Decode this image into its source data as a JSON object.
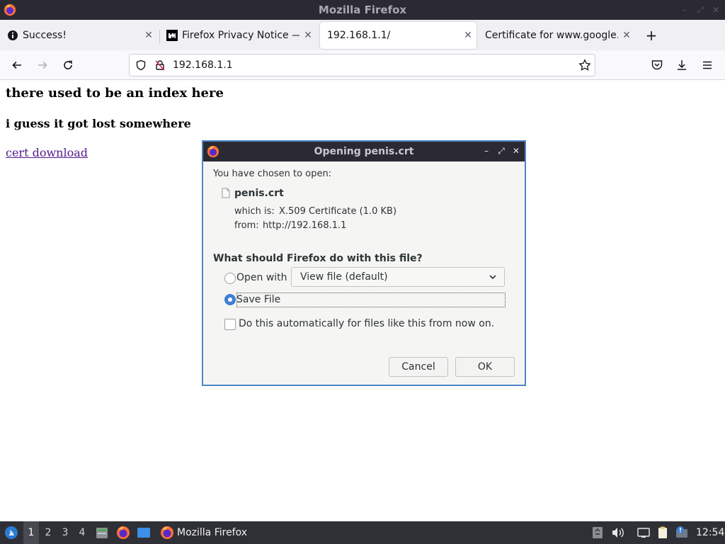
{
  "window": {
    "title": "Mozilla Firefox"
  },
  "tabs": [
    {
      "label": "Success!",
      "icon": "info-icon",
      "active": false
    },
    {
      "label": "Firefox Privacy Notice — ‖",
      "icon": "mozilla-m-icon",
      "active": false
    },
    {
      "label": "192.168.1.1/",
      "icon": "",
      "active": true
    },
    {
      "label": "Certificate for www.google.c",
      "icon": "",
      "active": false
    }
  ],
  "navbar": {
    "url": "192.168.1.1"
  },
  "page": {
    "heading1": "there used to be an index here",
    "heading2": "i guess it got lost somewhere",
    "link": "cert download"
  },
  "dialog": {
    "title": "Opening penis.crt",
    "intro": "You have chosen to open:",
    "filename": "penis.crt",
    "which_is_label": "which is:",
    "which_is_value": "X.509 Certificate (1.0 KB)",
    "from_label": "from:",
    "from_value": "http://192.168.1.1",
    "question": "What should Firefox do with this file?",
    "open_with_label": "Open with",
    "open_with_value": "View file (default)",
    "save_file_label": "Save File",
    "auto_label": "Do this automatically for files like this from now on.",
    "cancel_label": "Cancel",
    "ok_label": "OK",
    "selected_option": "save_file",
    "auto_checked": false
  },
  "taskbar": {
    "workspaces": [
      "1",
      "2",
      "3",
      "4"
    ],
    "active_workspace": "1",
    "app_label": "Mozilla Firefox",
    "clock": "12:54"
  },
  "colors": {
    "dialog_border": "#4a87c8",
    "radio_selected": "#3f7fd6",
    "link": "#551a8b"
  }
}
